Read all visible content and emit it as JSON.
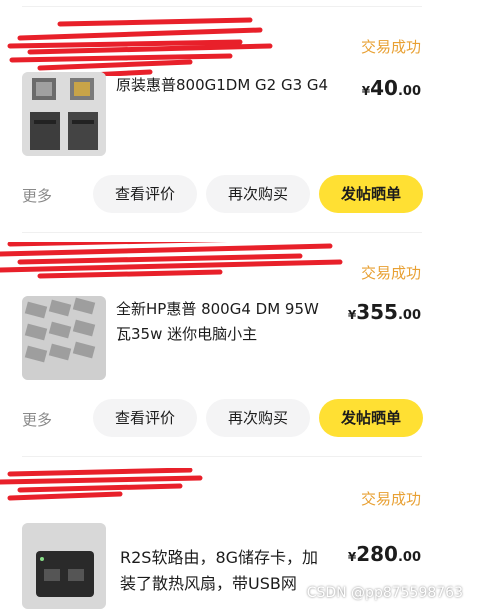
{
  "colors": {
    "status": "#e8a033",
    "primary_button": "#ffe033",
    "secondary_button": "#f4f4f5",
    "redaction": "#e8202a"
  },
  "orders": [
    {
      "status": "交易成功",
      "title": "原装惠普800G1DM G2 G3 G4",
      "price": {
        "currency": "¥",
        "integer": "40",
        "decimal": ".00"
      },
      "thumb_icon": "computer-parts-photo",
      "more": "更多",
      "buttons": [
        "查看评价",
        "再次购买",
        "发帖晒单"
      ]
    },
    {
      "status": "交易成功",
      "title": "全新HP惠普 800G4 DM 95W 瓦35w 迷你电脑小主",
      "price": {
        "currency": "¥",
        "integer": "355",
        "decimal": ".00"
      },
      "thumb_icon": "power-adapters-photo",
      "more": "更多",
      "buttons": [
        "查看评价",
        "再次购买",
        "发帖晒单"
      ]
    },
    {
      "status": "交易成功",
      "title": "R2S软路由，8G储存卡，加装了散热风扇，带USB网",
      "price": {
        "currency": "¥",
        "integer": "280",
        "decimal": ".00"
      },
      "thumb_icon": "router-device-photo"
    }
  ],
  "watermark": "CSDN @pp875598763"
}
